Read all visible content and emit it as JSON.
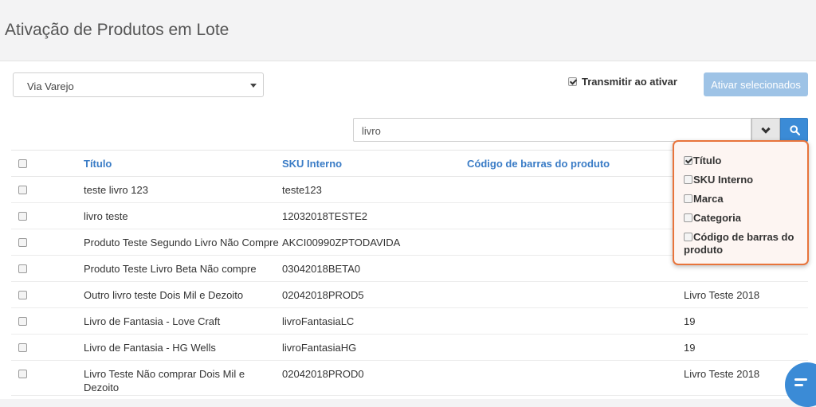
{
  "page": {
    "title": "Ativação de Produtos em Lote"
  },
  "toolbar": {
    "marketplace_value": "Via Varejo",
    "transmit_label": "Transmitir ao ativar",
    "transmit_checked": true,
    "activate_label": "Ativar selecionados"
  },
  "search": {
    "value": "livro"
  },
  "table": {
    "headers": {
      "title": "Título",
      "sku": "SKU Interno",
      "barcode": "Código de barras do produto"
    },
    "rows": [
      {
        "title": "teste livro 123",
        "sku": "teste123",
        "barcode": "",
        "extra": ""
      },
      {
        "title": "livro teste",
        "sku": "12032018TESTE2",
        "barcode": "",
        "extra": ""
      },
      {
        "title": "Produto Teste Segundo Livro Não Compre",
        "sku": "AKCI00990ZPTODAVIDA",
        "barcode": "",
        "extra": ""
      },
      {
        "title": "Produto Teste Livro Beta Não compre",
        "sku": "03042018BETA0",
        "barcode": "",
        "extra": ""
      },
      {
        "title": "Outro livro teste Dois Mil e Dezoito",
        "sku": "02042018PROD5",
        "barcode": "",
        "extra": "Livro Teste 2018"
      },
      {
        "title": "Livro de Fantasia - Love Craft",
        "sku": "livroFantasiaLC",
        "barcode": "",
        "extra": "19"
      },
      {
        "title": "Livro de Fantasia - HG Wells",
        "sku": "livroFantasiaHG",
        "barcode": "",
        "extra": "19"
      },
      {
        "title": "Livro Teste Não comprar Dois Mil e Dezoito",
        "sku": "02042018PROD0",
        "barcode": "",
        "extra": "Livro Teste 2018"
      }
    ]
  },
  "filter_menu": {
    "options": [
      {
        "label": "Título",
        "checked": true
      },
      {
        "label": "SKU Interno",
        "checked": false
      },
      {
        "label": "Marca",
        "checked": false
      },
      {
        "label": "Categoria",
        "checked": false
      },
      {
        "label": "Código de barras do produto",
        "checked": false
      }
    ]
  },
  "icons": {
    "dropdown": "chevron-down-icon",
    "search": "search-icon",
    "chat": "chat-icon"
  },
  "colors": {
    "accent": "#3b8bd6",
    "header_text": "#3a7cc6",
    "popup_border": "#e8743b",
    "disabled_button": "#9ec3e6"
  }
}
